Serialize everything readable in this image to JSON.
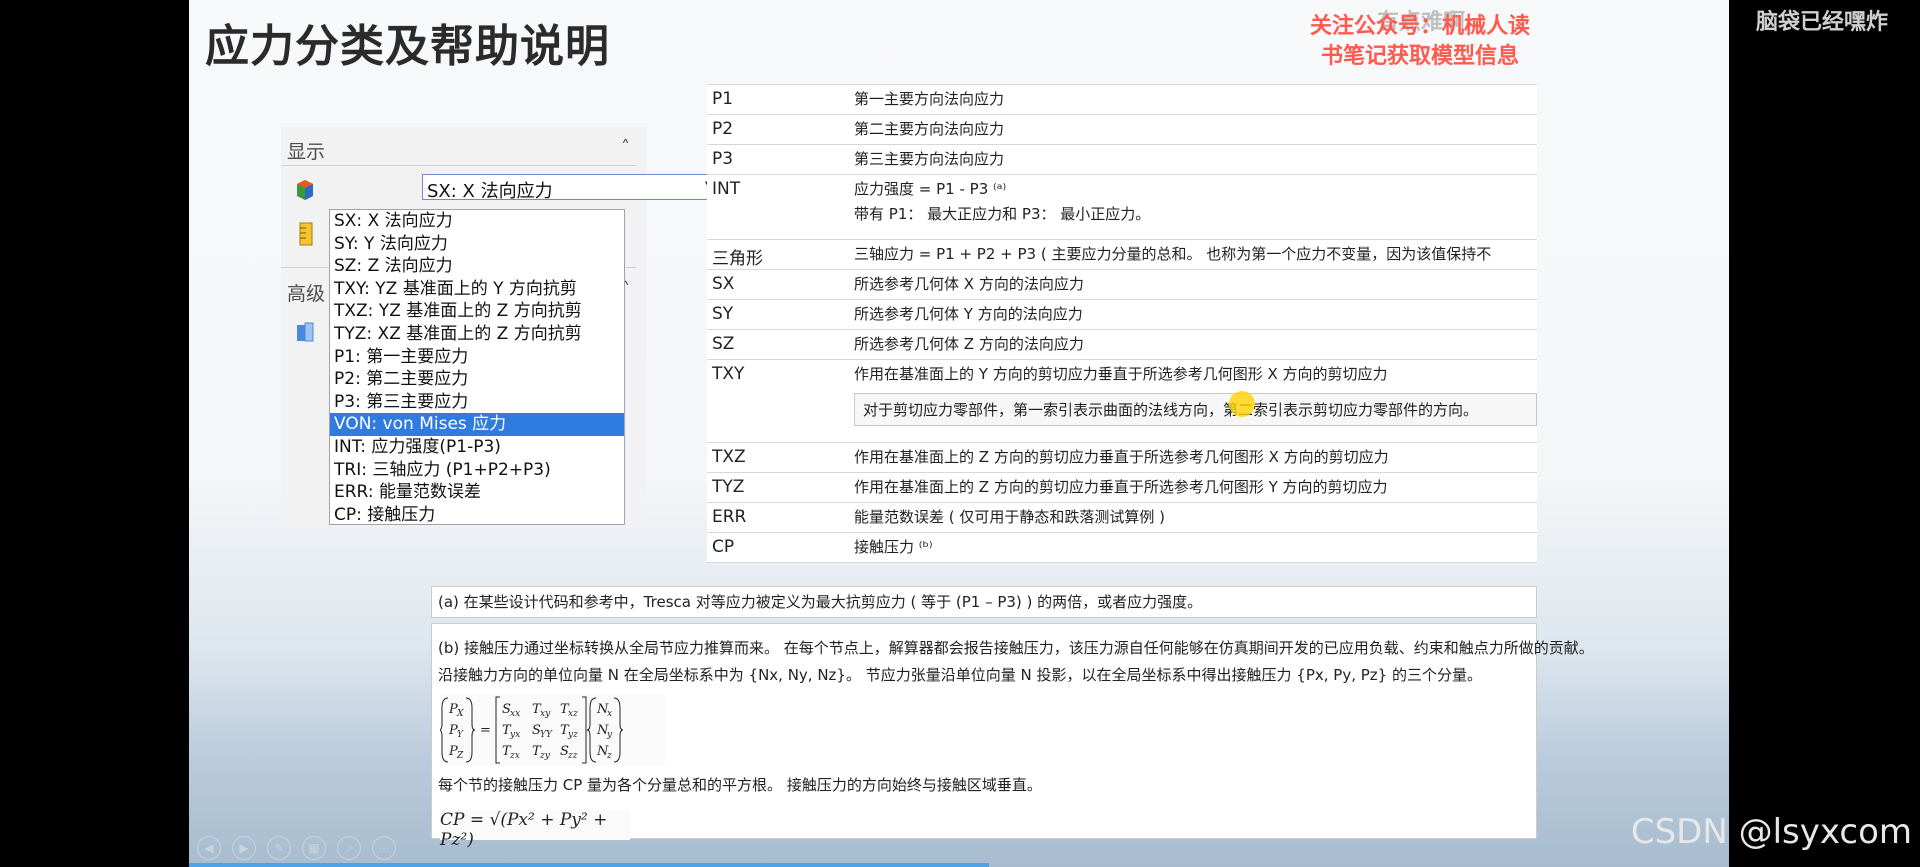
{
  "slide": {
    "title": "应力分类及帮助说明",
    "watermarks": [
      "有点难啊",
      "脑袋已经嘿炸"
    ],
    "promo_lines": [
      "关注公众号：机械人读",
      "书笔记获取模型信息"
    ]
  },
  "panel": {
    "display_section": "显示",
    "advanced_section": "高级",
    "selected_value": "SX: X 法向应力",
    "options": [
      "SX: X 法向应力",
      "SY: Y 法向应力",
      "SZ: Z 法向应力",
      "TXY: YZ 基准面上的 Y 方向抗剪",
      "TXZ: YZ 基准面上的 Z 方向抗剪",
      "TYZ: XZ 基准面上的 Z 方向抗剪",
      "P1: 第一主要应力",
      "P2: 第二主要应力",
      "P3: 第三主要应力",
      "VON: von Mises 应力",
      "INT: 应力强度(P1-P3)",
      "TRI: 三轴应力 (P1+P2+P3)",
      "ERR: 能量范数误差",
      "CP: 接触压力"
    ],
    "highlighted_index": 9
  },
  "definitions": [
    {
      "code": "P1",
      "desc": "第一主要方向法向应力"
    },
    {
      "code": "P2",
      "desc": "第二主要方向法向应力"
    },
    {
      "code": "P3",
      "desc": "第三主要方向法向应力"
    },
    {
      "code": "INT",
      "desc": "应力强度 = P1 - P3 ⁽ᵃ⁾",
      "desc2": "带有 P1： 最大正应力和 P3： 最小正应力。"
    },
    {
      "code": "三角形",
      "desc": "三轴应力 = P1 + P2 + P3 ( 主要应力分量的总和。 也称为第一个应力不变量，因为该值保持不"
    },
    {
      "code": "SX",
      "desc": "所选参考几何体 X 方向的法向应力"
    },
    {
      "code": "SY",
      "desc": "所选参考几何体 Y 方向的法向应力"
    },
    {
      "code": "SZ",
      "desc": "所选参考几何体 Z 方向的法向应力"
    },
    {
      "code": "TXY",
      "desc": "作用在基准面上的 Y 方向的剪切应力垂直于所选参考几何图形 X 方向的剪切应力",
      "note": "对于剪切应力零部件，第一索引表示曲面的法线方向，第二索引表示剪切应力零部件的方向。"
    },
    {
      "code": "TXZ",
      "desc": "作用在基准面上的 Z 方向的剪切应力垂直于所选参考几何图形 X 方向的剪切应力"
    },
    {
      "code": "TYZ",
      "desc": "作用在基准面上的 Z 方向的剪切应力垂直于所选参考几何图形 Y 方向的剪切应力"
    },
    {
      "code": "ERR",
      "desc": "能量范数误差 ( 仅可用于静态和跌落测试算例 )"
    },
    {
      "code": "CP",
      "desc": "接触压力 ⁽ᵇ⁾"
    }
  ],
  "notes": {
    "a": "(a) 在某些设计代码和参考中，Tresca 对等应力被定义为最大抗剪应力 ( 等于 (P1 – P3) ) 的两倍，或者应力强度。",
    "b1": "(b) 接触压力通过坐标转换从全局节应力推算而来。 在每个节点上，解算器都会报告接触压力，该压力源自任何能够在仿真期间开发的已应用负载、约束和触点力所做的贡献。",
    "b2": "沿接触力方向的单位向量 N 在全局坐标系中为 {Nx, Ny, Nz}。 节应力张量沿单位向量 N 投影，以在全局坐标系中得出接触压力 {Px, Py, Pz} 的三个分量。",
    "b3": "每个节的接触压力 CP 量为各个分量总和的平方根。 接触压力的方向始终与接触区域垂直。",
    "cp_formula": "CP = √(Px² + Py² + Pz²)"
  },
  "footer": {
    "csdn": "CSDN @lsyxcom"
  }
}
